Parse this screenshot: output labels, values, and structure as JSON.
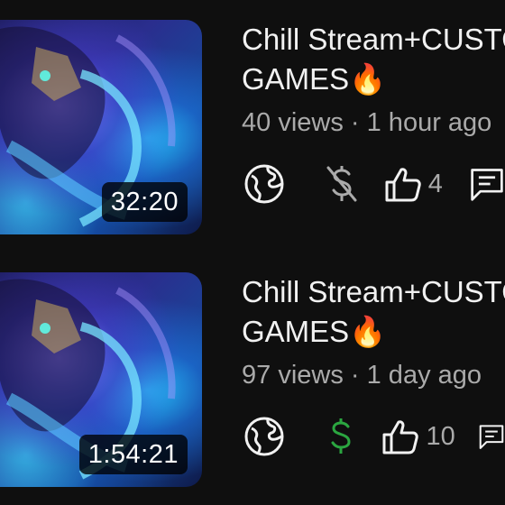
{
  "videos": [
    {
      "title_line1": "Chill Stream+CUSTOM",
      "title_line2": "GAMES🔥",
      "views": "40 views",
      "separator": "·",
      "age": "1 hour ago",
      "duration": "32:20",
      "visibility_icon": "globe-icon",
      "monetization_icon": "dollar-off-icon",
      "monetization_color": "#aaaaaa",
      "likes": "4",
      "comment_icon": "comment-icon"
    },
    {
      "title_line1": "Chill Stream+CUSTOM",
      "title_line2": "GAMES🔥",
      "views": "97 views",
      "separator": "·",
      "age": "1 day ago",
      "duration": "1:54:21",
      "visibility_icon": "globe-icon",
      "monetization_icon": "dollar-icon",
      "monetization_color": "#2ba640",
      "likes": "10",
      "comment_icon": "comment-icon"
    }
  ]
}
